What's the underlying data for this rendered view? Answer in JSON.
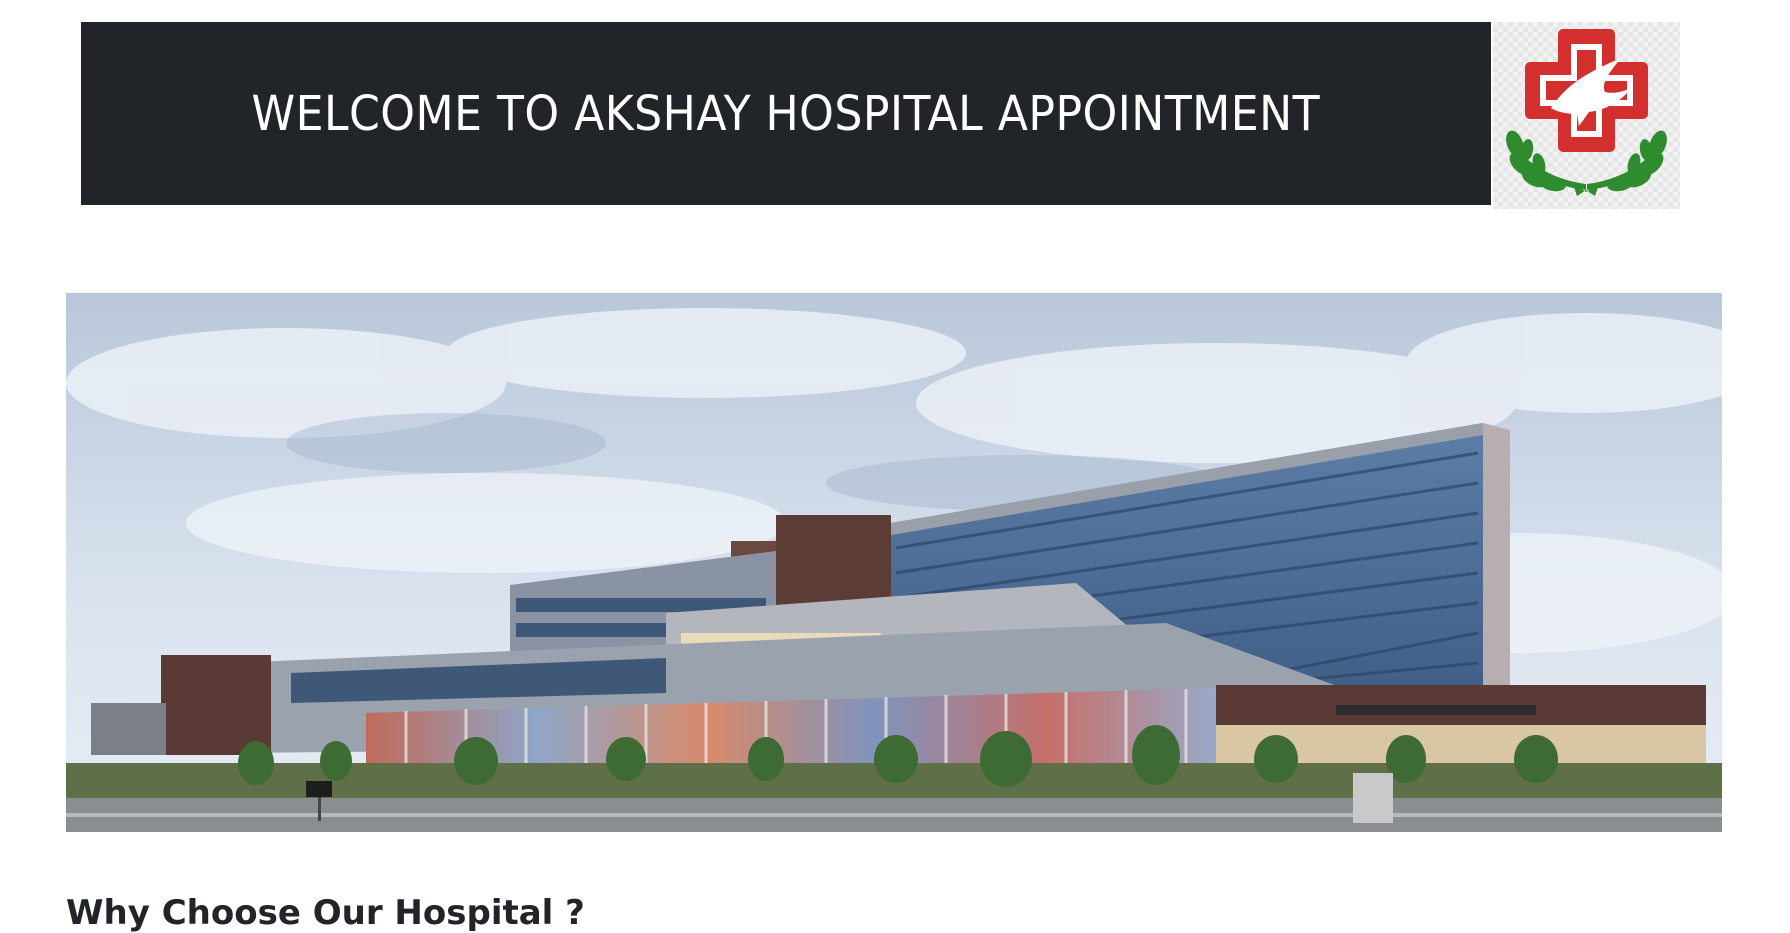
{
  "header": {
    "title": "WELCOME TO AKSHAY HOSPITAL APPOINTMENT",
    "background_color": "#212529",
    "text_color": "#ffffff"
  },
  "logo": {
    "icon": "hospital-cross-dove-logo-icon",
    "colors": {
      "cross": "#d32f2f",
      "laurel": "#2e8b2e",
      "dove": "#ffffff"
    }
  },
  "hero": {
    "image": "hospital-building-photo"
  },
  "section": {
    "heading": "Why Choose Our Hospital ?"
  }
}
